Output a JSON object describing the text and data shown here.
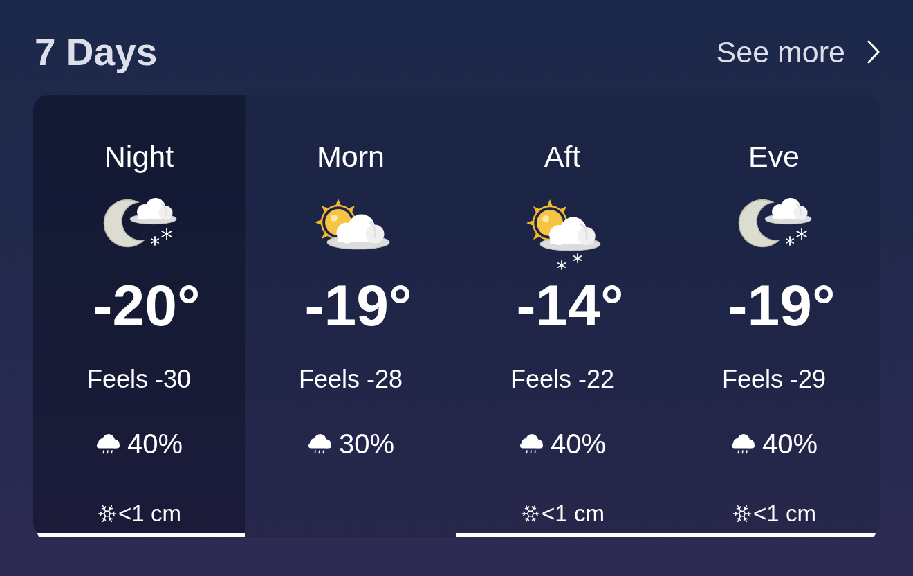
{
  "header": {
    "title": "7 Days",
    "link": "See more"
  },
  "periods": [
    {
      "label": "Night",
      "selected": true,
      "kind": "moon-snow",
      "temperature": "-20°",
      "feels": "Feels -30",
      "precipitation": "40%",
      "snow": "<1 cm",
      "snow_bar": true
    },
    {
      "label": "Morn",
      "selected": false,
      "kind": "sun-cloud",
      "temperature": "-19°",
      "feels": "Feels -28",
      "precipitation": "30%",
      "snow_bar": false
    },
    {
      "label": "Aft",
      "selected": false,
      "kind": "sun-snow",
      "temperature": "-14°",
      "feels": "Feels -22",
      "precipitation": "40%",
      "snow": "<1 cm",
      "snow_bar": true
    },
    {
      "label": "Eve",
      "selected": false,
      "kind": "moon-snow",
      "temperature": "-19°",
      "feels": "Feels -29",
      "precipitation": "40%",
      "snow": "<1 cm",
      "snow_bar": true
    }
  ]
}
